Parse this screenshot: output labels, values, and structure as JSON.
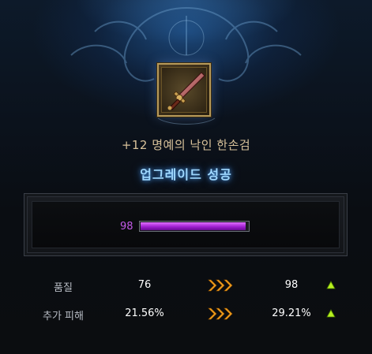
{
  "item": {
    "name": "+12 명예의 낙인 한손검",
    "icon": "one-handed-sword-icon"
  },
  "result": {
    "text": "업그레이드 성공"
  },
  "gauge": {
    "value_label": "98",
    "fill_fraction": 0.98,
    "color": "#b030e0"
  },
  "stats": [
    {
      "label": "품질",
      "before": "76",
      "after": "98",
      "arrow_icon": "triple-chevron-right-icon",
      "change_icon": "increase-triangle-icon"
    },
    {
      "label": "추가 피해",
      "before": "21.56%",
      "after": "29.21%",
      "arrow_icon": "triple-chevron-right-icon",
      "change_icon": "increase-triangle-icon"
    }
  ],
  "colors": {
    "accent_gold": "#f0a020",
    "increase_green": "#b8f020",
    "result_blue": "#9fd8ff"
  }
}
